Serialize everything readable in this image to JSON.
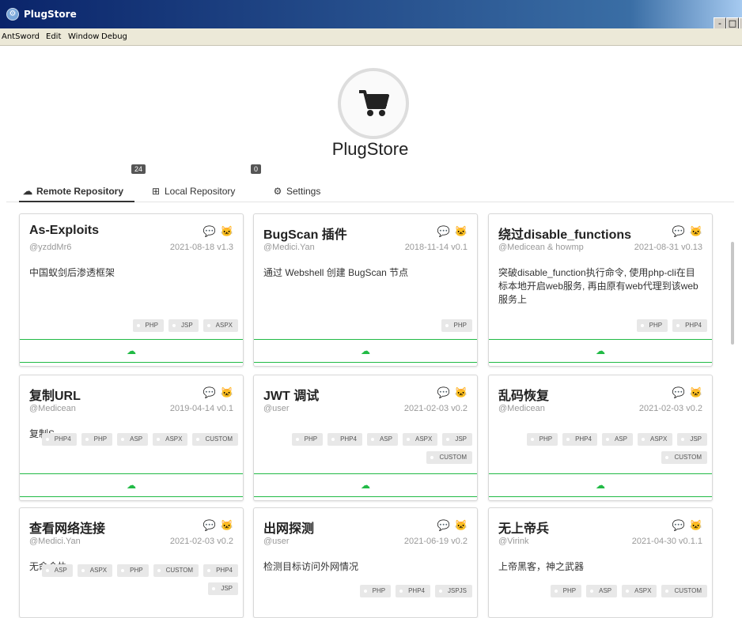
{
  "window": {
    "title": "PlugStore",
    "minimize": "-",
    "maximize": "□",
    "close": "x"
  },
  "menu": [
    "AntSword",
    "Edit",
    "Window",
    "Debug"
  ],
  "store": {
    "title": "PlugStore",
    "logo_icon": "shopping-cart-icon"
  },
  "tabs": [
    {
      "label": "Remote Repository",
      "icon": "cloud-icon",
      "count": "24",
      "active": true
    },
    {
      "label": "Local Repository",
      "icon": "sitemap-icon",
      "count": "0",
      "active": false
    },
    {
      "label": "Settings",
      "icon": "gear-icon",
      "active": false
    }
  ],
  "cards": [
    {
      "name": "As-Exploits",
      "author": "@yzddMr6",
      "date": "2021-08-18 v1.3",
      "desc": "中国蚁剑后渗透框架",
      "tags": [
        "PHP",
        "JSP",
        "ASPX"
      ]
    },
    {
      "name": "BugScan 插件",
      "author": "@Medici.Yan",
      "date": "2018-11-14 v0.1",
      "desc": "通过 Webshell 创建 BugScan 节点",
      "tags": [
        "PHP"
      ]
    },
    {
      "name": "绕过disable_functions",
      "author": "@Medicean & howmp",
      "date": "2021-08-31 v0.13",
      "desc": "突破disable_function执行命令, 使用php-cli在目标本地开启web服务, 再由原有web代理到该web服务上",
      "tags": [
        "PHP",
        "PHP4"
      ]
    },
    {
      "name": "复制URL",
      "author": "@Medicean",
      "date": "2019-04-14 v0.1",
      "desc": "复制S",
      "tags": [
        "PHP4",
        "PHP",
        "ASP",
        "ASPX",
        "CUSTOM"
      ]
    },
    {
      "name": "JWT 调试",
      "author": "@user",
      "date": "2021-02-03 v0.2",
      "desc": "",
      "tags": [
        "PHP",
        "PHP4",
        "ASP",
        "ASPX",
        "JSP",
        "CUSTOM"
      ]
    },
    {
      "name": "乱码恢复",
      "author": "@Medicean",
      "date": "2021-02-03 v0.2",
      "desc": "",
      "tags": [
        "PHP",
        "PHP4",
        "ASP",
        "ASPX",
        "JSP",
        "CUSTOM"
      ]
    },
    {
      "name": "查看网络连接",
      "author": "@Medici.Yan",
      "date": "2021-02-03 v0.2",
      "desc": "无命令执",
      "tags": [
        "ASP",
        "ASPX",
        "PHP",
        "CUSTOM",
        "PHP4",
        "JSP"
      ]
    },
    {
      "name": "出网探测",
      "author": "@user",
      "date": "2021-06-19 v0.2",
      "desc": "检测目标访问外网情况",
      "tags": [
        "PHP",
        "PHP4",
        "JSPJS"
      ]
    },
    {
      "name": "无上帝兵",
      "author": "@Virink",
      "date": "2021-04-30 v0.1.1",
      "desc": "上帝黑客，神之武器",
      "tags": [
        "PHP",
        "ASP",
        "ASPX",
        "CUSTOM"
      ]
    }
  ]
}
